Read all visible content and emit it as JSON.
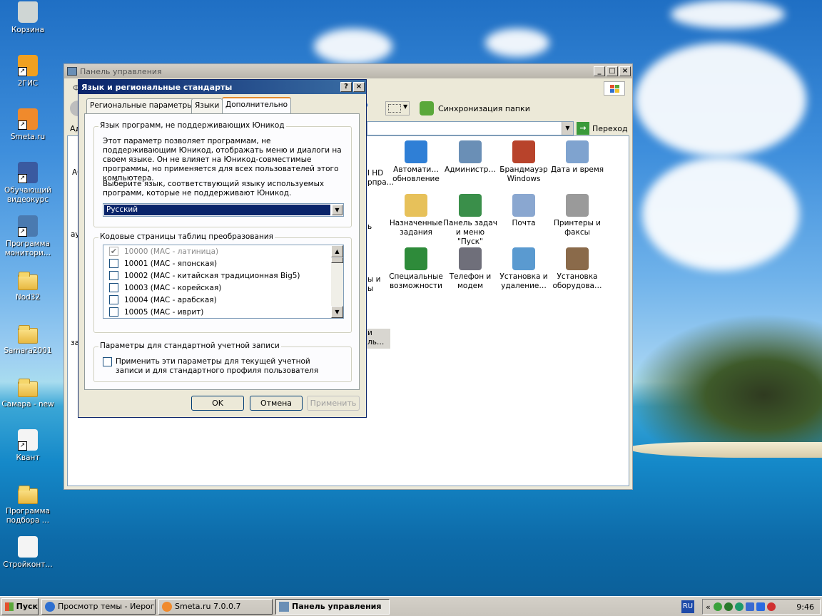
{
  "desktop": {
    "icons": [
      {
        "label": "Корзина",
        "icon": "recycle-bin-icon"
      },
      {
        "label": "2ГИС",
        "icon": "2gis-icon"
      },
      {
        "label": "Smeta.ru",
        "icon": "smeta-icon"
      },
      {
        "label": "Обучающий видеокурс",
        "icon": "video-camera-icon"
      },
      {
        "label": "Программа монитори…",
        "icon": "monitor-program-icon"
      },
      {
        "label": "Nod32",
        "icon": "folder-icon"
      },
      {
        "label": "Samara2001",
        "icon": "folder-icon"
      },
      {
        "label": "Самара - new",
        "icon": "folder-icon"
      },
      {
        "label": "Квант",
        "icon": "avi-file-icon"
      },
      {
        "label": "Программа подбора …",
        "icon": "zip-folder-icon"
      },
      {
        "label": "Стройконт…",
        "icon": "excel-file-icon"
      }
    ]
  },
  "control_panel": {
    "title": "Панель управления",
    "menu_first_letter": "Ф",
    "address_label": "Ад",
    "sync_label": "Синхронизация папки",
    "go_label": "Переход",
    "partial_left": [
      "АС",
      "ау",
      "з",
      "зам"
    ],
    "partial_items": [
      "l HD\nрпра…",
      "ь",
      "ы и\nы",
      "и\nль…"
    ],
    "items": [
      {
        "label": "Автомати… обновление",
        "icon": "windows-update-icon",
        "color": "#2f7fd6"
      },
      {
        "label": "Администр…",
        "icon": "admin-tools-icon",
        "color": "#6a8fb6"
      },
      {
        "label": "Брандмауэр Windows",
        "icon": "firewall-icon",
        "color": "#b8432b"
      },
      {
        "label": "Дата и время",
        "icon": "clock-icon",
        "color": "#7fa3cf"
      },
      {
        "label": "Назначенные задания",
        "icon": "scheduled-tasks-icon",
        "color": "#e7c15a"
      },
      {
        "label": "Панель задач и меню \"Пуск\"",
        "icon": "taskbar-icon",
        "color": "#3a8f4a"
      },
      {
        "label": "Почта",
        "icon": "mail-icon",
        "color": "#8aa7d0"
      },
      {
        "label": "Принтеры и факсы",
        "icon": "printer-icon",
        "color": "#9a9a9a"
      },
      {
        "label": "Специальные возможности",
        "icon": "accessibility-icon",
        "color": "#2e8b3a"
      },
      {
        "label": "Телефон и модем",
        "icon": "phone-icon",
        "color": "#6f6f7a"
      },
      {
        "label": "Установка и удаление…",
        "icon": "add-remove-icon",
        "color": "#5a9ad0"
      },
      {
        "label": "Установка оборудова…",
        "icon": "hardware-icon",
        "color": "#8a6a4a"
      }
    ]
  },
  "dialog": {
    "title": "Язык и региональные стандарты",
    "tabs": [
      "Региональные параметры",
      "Языки",
      "Дополнительно"
    ],
    "selected_tab": "Дополнительно",
    "group1": {
      "title": "Язык программ, не поддерживающих Юникод",
      "description": "Этот параметр позволяет программам, не поддерживающим Юникод, отображать меню и диалоги на своем языке. Он не влияет на Юникод-совместимые программы, но применяется для всех пользователей этого компьютера.",
      "prompt": "Выберите язык, соответствующий языку используемых программ, которые не поддерживают Юникод.",
      "selected_language": "Русский"
    },
    "group2": {
      "title": "Кодовые страницы таблиц преобразования",
      "rows": [
        {
          "label": "10000 (MAC - латиница)",
          "checked": true,
          "disabled": true
        },
        {
          "label": "10001 (MAC - японская)",
          "checked": false,
          "disabled": false
        },
        {
          "label": "10002 (MAC - китайская традиционная Big5)",
          "checked": false,
          "disabled": false
        },
        {
          "label": "10003 (MAC - корейская)",
          "checked": false,
          "disabled": false
        },
        {
          "label": "10004 (MAC - арабская)",
          "checked": false,
          "disabled": false
        },
        {
          "label": "10005 (MAC - иврит)",
          "checked": false,
          "disabled": false
        }
      ]
    },
    "group3": {
      "title": "Параметры для стандартной учетной записи",
      "checkbox_label": "Применить эти параметры для текущей учетной записи и для стандартного профиля пользователя"
    },
    "buttons": {
      "ok": "OK",
      "cancel": "Отмена",
      "apply": "Применить"
    }
  },
  "taskbar": {
    "start": "Пуск",
    "tasks": [
      {
        "label": "Просмотр темы - Иерог…",
        "pressed": false
      },
      {
        "label": "Smeta.ru  7.0.0.7",
        "pressed": false
      },
      {
        "label": "Панель управления",
        "pressed": true
      }
    ],
    "language": "RU",
    "clock": "9:46"
  }
}
